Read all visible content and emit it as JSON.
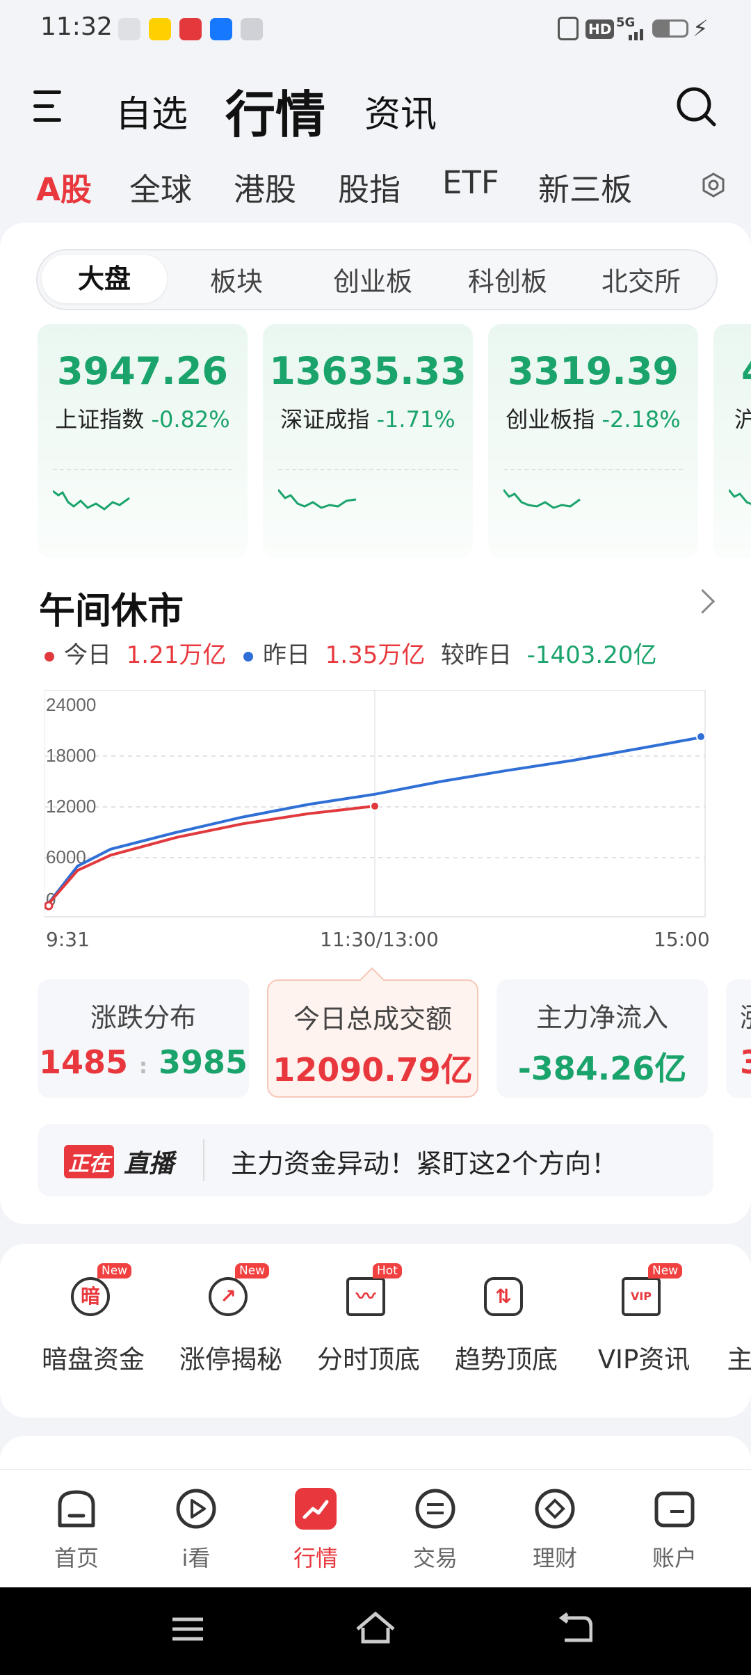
{
  "status_bar": {
    "time": "11:32",
    "hd": "HD",
    "net": "5G"
  },
  "header": {
    "tabs": [
      "自选",
      "行情",
      "资讯"
    ],
    "active_tab": "行情"
  },
  "market_tabs": [
    "A股",
    "全球",
    "港股",
    "股指",
    "ETF",
    "新三板"
  ],
  "segments": [
    "大盘",
    "板块",
    "创业板",
    "科创板",
    "北交所"
  ],
  "indices": [
    {
      "value": "3947.26",
      "name": "上证指数",
      "change": "-0.82%"
    },
    {
      "value": "13635.33",
      "name": "深证成指",
      "change": "-1.71%"
    },
    {
      "value": "3319.39",
      "name": "创业板指",
      "change": "-2.18%"
    },
    {
      "value": "4",
      "name": "沪",
      "change": ""
    }
  ],
  "turnover": {
    "title": "午间休市",
    "today_label": "今日",
    "today_value": "1.21万亿",
    "yesterday_label": "昨日",
    "yesterday_value": "1.35万亿",
    "diff_label": "较昨日",
    "diff_value": "-1403.20亿"
  },
  "chart_data": {
    "type": "line",
    "y_ticks": [
      "24000",
      "18000",
      "12000",
      "6000",
      "0"
    ],
    "x_ticks": [
      "9:31",
      "11:30/13:00",
      "15:00"
    ],
    "ylim": [
      0,
      24000
    ],
    "series": [
      {
        "name": "今日",
        "color": "#e03a3e",
        "x": [
          0,
          0.05,
          0.1,
          0.2,
          0.3,
          0.4,
          0.5
        ],
        "y": [
          0,
          4500,
          6300,
          8400,
          10000,
          11200,
          12090
        ]
      },
      {
        "name": "昨日",
        "color": "#2f6fd6",
        "x": [
          0,
          0.05,
          0.1,
          0.2,
          0.3,
          0.4,
          0.5,
          0.6,
          0.7,
          0.8,
          0.9,
          1.0
        ],
        "y": [
          0,
          5000,
          7000,
          9000,
          10800,
          12300,
          13500,
          15000,
          16300,
          17500,
          18900,
          20300
        ]
      }
    ]
  },
  "stats": [
    {
      "label": "涨跌分布",
      "up": "1485",
      "sep": ":",
      "down": "3985"
    },
    {
      "label": "今日总成交额",
      "value": "12090.79亿"
    },
    {
      "label": "主力净流入",
      "value": "-384.26亿"
    },
    {
      "label": "涨",
      "value": "3"
    }
  ],
  "live": {
    "tag1": "正在",
    "tag2": "直播",
    "text": "主力资金异动！紧盯这2个方向！"
  },
  "tools": [
    {
      "label": "暗盘资金",
      "badge": "New",
      "glyph": "暗"
    },
    {
      "label": "涨停揭秘",
      "badge": "New",
      "glyph": "↗"
    },
    {
      "label": "分时顶底",
      "badge": "Hot",
      "glyph": "〰"
    },
    {
      "label": "趋势顶底",
      "badge": "",
      "glyph": "⇅"
    },
    {
      "label": "VIP资讯",
      "badge": "New",
      "glyph": "VIP"
    },
    {
      "label": "主",
      "badge": "",
      "glyph": ""
    }
  ],
  "bottom_nav": [
    "首页",
    "i看",
    "行情",
    "交易",
    "理财",
    "账户"
  ],
  "colors": {
    "accent_red": "#e8383d",
    "up_red": "#e03a3e",
    "down_green": "#1aa36b",
    "blue_line": "#2f6fd6"
  }
}
